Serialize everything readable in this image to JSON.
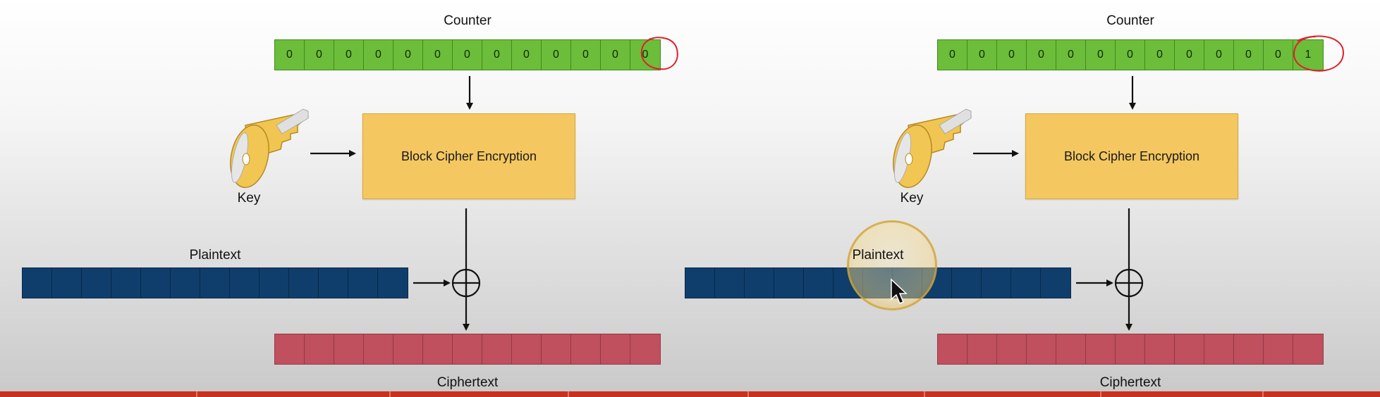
{
  "panels": [
    {
      "counter_label": "Counter",
      "counter_values": [
        "0",
        "0",
        "0",
        "0",
        "0",
        "0",
        "0",
        "0",
        "0",
        "0",
        "0",
        "0",
        "0"
      ],
      "key_label": "Key",
      "cipher_label": "Block Cipher Encryption",
      "plaintext_label": "Plaintext",
      "ciphertext_label": "Ciphertext"
    },
    {
      "counter_label": "Counter",
      "counter_values": [
        "0",
        "0",
        "0",
        "0",
        "0",
        "0",
        "0",
        "0",
        "0",
        "0",
        "0",
        "0",
        "1"
      ],
      "key_label": "Key",
      "cipher_label": "Block Cipher Encryption",
      "plaintext_label": "Plaintext",
      "ciphertext_label": "Ciphertext"
    }
  ],
  "colors": {
    "counter": "#6cbd3a",
    "cipher_box": "#f4c760",
    "plaintext": "#0f3e6c",
    "ciphertext": "#c0505e",
    "annotation": "#e0202a"
  }
}
